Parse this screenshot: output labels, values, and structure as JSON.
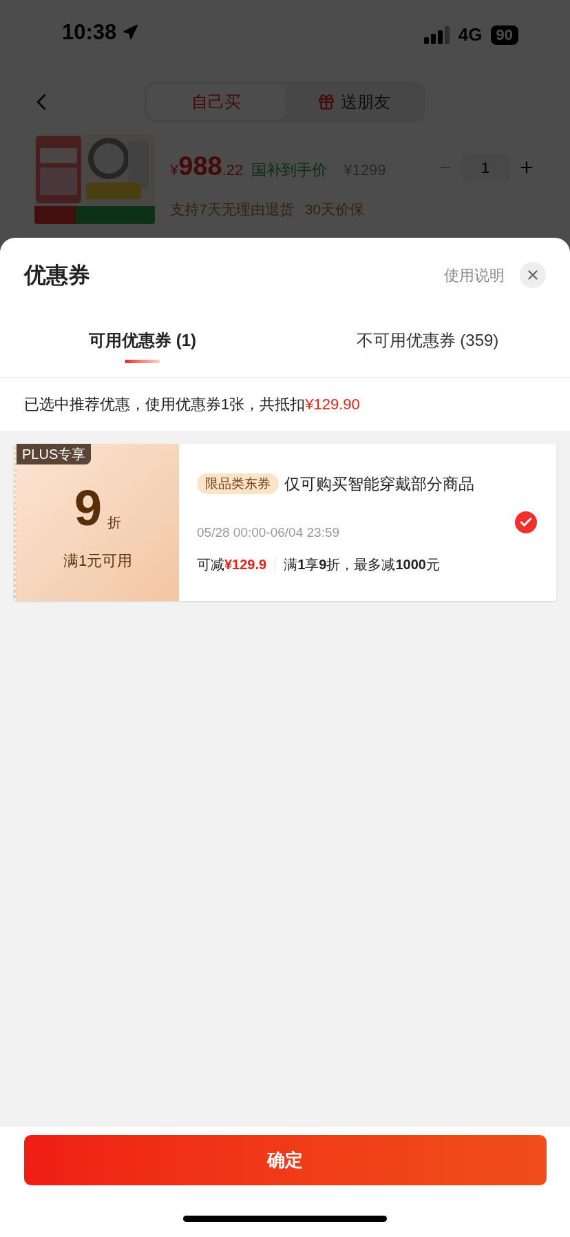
{
  "status_bar": {
    "time": "10:38",
    "network": "4G",
    "battery": "90"
  },
  "header": {
    "tabs": [
      {
        "label": "自己买",
        "selected": true,
        "kind": "plain"
      },
      {
        "label": "送朋友",
        "selected": false,
        "kind": "gift"
      }
    ]
  },
  "product": {
    "currency": "¥",
    "price_integer": "988",
    "price_decimal": ".22",
    "price_label": "国补到手价",
    "original_price": "¥1299",
    "quantity": "1",
    "services": [
      "支持7天无理由退货",
      "30天价保"
    ]
  },
  "sheet": {
    "title": "优惠券",
    "help_link": "使用说明",
    "tabs": [
      {
        "label": "可用优惠券 (1)",
        "selected": true
      },
      {
        "label": "不可用优惠券 (359)",
        "selected": false
      }
    ],
    "summary": {
      "text": "已选中推荐优惠，使用优惠券1张，共抵扣",
      "amount": "¥129.90"
    },
    "coupons": [
      {
        "badge": "PLUS专享",
        "value": "9",
        "unit": "折",
        "condition": "满1元可用",
        "tag": "限品类东券",
        "title": "仅可购买智能穿戴部分商品",
        "validity": "05/28 00:00-06/04 23:59",
        "saving_label": "可减",
        "saving_amount": "¥129.9",
        "rule": "满**1**享**9**折，最多减**1000**元",
        "selected": true
      }
    ],
    "confirm_button": "确定"
  }
}
